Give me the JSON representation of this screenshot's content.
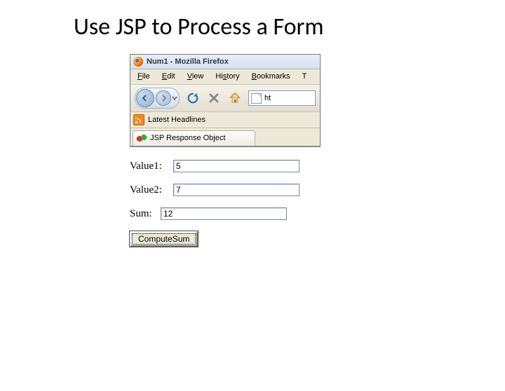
{
  "slide": {
    "title": "Use JSP to Process a Form"
  },
  "window": {
    "title": "Num1 - Mozilla Firefox"
  },
  "menu": {
    "file": "File",
    "edit": "Edit",
    "view": "View",
    "history": "History",
    "bookmarks": "Bookmarks",
    "tools_partial": "T"
  },
  "bookmarks_bar": {
    "latest_headlines": "Latest Headlines"
  },
  "url": {
    "partial": "ht"
  },
  "tab": {
    "label": "JSP Response Object"
  },
  "form": {
    "value1": {
      "label": "Value1:",
      "value": "5"
    },
    "value2": {
      "label": "Value2:",
      "value": "7"
    },
    "sum": {
      "label": "Sum:",
      "value": "12"
    },
    "button": "ComputeSum"
  }
}
